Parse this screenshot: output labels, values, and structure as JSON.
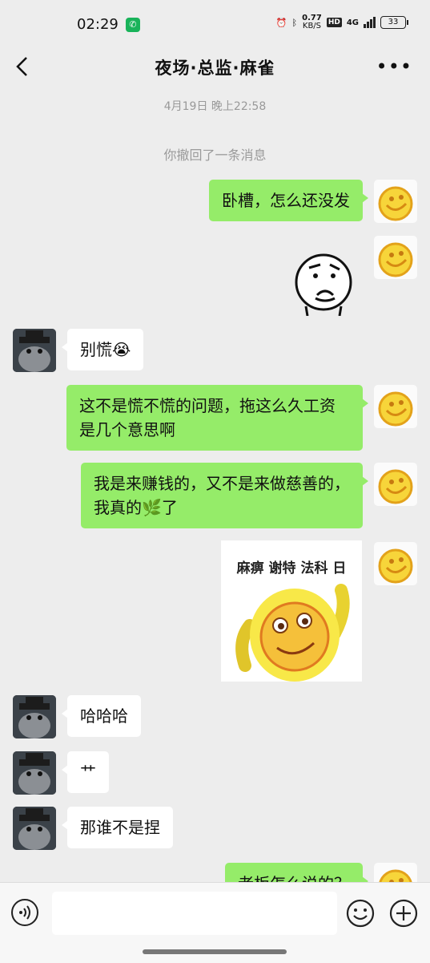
{
  "status_bar": {
    "time": "02:29",
    "speed_value": "0.77",
    "speed_unit": "KB/S",
    "hd": "HD",
    "network": "4G",
    "battery": "33"
  },
  "header": {
    "title": "夜场·总监·麻雀"
  },
  "chat": {
    "timestamp": "4月19日 晚上22:58",
    "recall_notice": "你撤回了一条消息",
    "messages": [
      {
        "from": "me",
        "text": "卧槽，怎么还没发"
      },
      {
        "from": "me",
        "sticker": "worried-face-sticker"
      },
      {
        "from": "other",
        "text": "别慌",
        "emoji": "😭"
      },
      {
        "from": "me",
        "text": "这不是慌不慌的问题，拖这么久工资是几个意思啊"
      },
      {
        "from": "me",
        "text_a": "我是来赚钱的，又不是来做慈善的，我真的",
        "emoji": "🌿",
        "text_b": "了"
      },
      {
        "from": "me",
        "sticker": "smiley-meme-sticker",
        "sticker_caption": "麻痹 谢特 法科 日"
      },
      {
        "from": "other",
        "text": "哈哈哈"
      },
      {
        "from": "other",
        "text": "艹"
      },
      {
        "from": "other",
        "text": "那谁不是捏"
      },
      {
        "from": "me",
        "text": "老板怎么说的？"
      }
    ]
  },
  "input_bar": {
    "placeholder": ""
  },
  "colors": {
    "my_bubble": "#95ec69",
    "other_bubble": "#ffffff",
    "background": "#ededed"
  }
}
